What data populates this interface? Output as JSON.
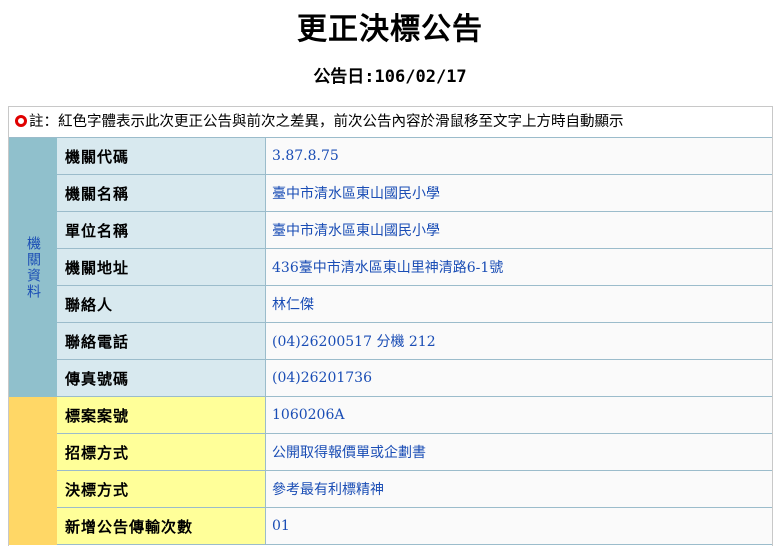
{
  "header": {
    "title": "更正決標公告",
    "date_line": "公告日:106/02/17"
  },
  "note": {
    "text": "註：紅色字體表示此次更正公告與前次之差異，前次公告內容於滑鼠移至文字上方時自動顯示",
    "marker_color": "#e00000"
  },
  "agency_section": {
    "label": "機關資料",
    "color": "#90c0cc",
    "rows": [
      {
        "label": "機關代碼",
        "value": "3.87.8.75"
      },
      {
        "label": "機關名稱",
        "value": "臺中市清水區東山國民小學"
      },
      {
        "label": "單位名稱",
        "value": "臺中市清水區東山國民小學"
      },
      {
        "label": "機關地址",
        "value": "436臺中市清水區東山里神清路6-1號"
      },
      {
        "label": "聯絡人",
        "value": "林仁傑"
      },
      {
        "label": "聯絡電話",
        "value": "(04)26200517 分機 212"
      },
      {
        "label": "傳真號碼",
        "value": "(04)26201736"
      }
    ]
  },
  "tender_section": {
    "label": "",
    "color": "#ffd766",
    "rows": [
      {
        "label": "標案案號",
        "value": "1060206A"
      },
      {
        "label": "招標方式",
        "value": "公開取得報價單或企劃書"
      },
      {
        "label": "決標方式",
        "value": "參考最有利標精神"
      },
      {
        "label": "新增公告傳輸次數",
        "value": "01"
      }
    ]
  },
  "colors": {
    "value_text": "#1a4db5",
    "agency_label_bg": "#d8e9ef",
    "tender_label_bg": "#ffff99"
  }
}
